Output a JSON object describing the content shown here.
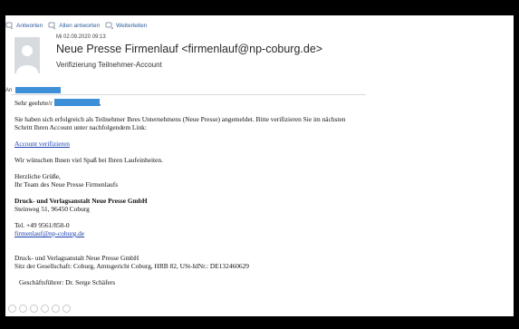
{
  "toolbar": {
    "reply": "Antworten",
    "reply_all": "Allen antworten",
    "forward": "Weiterleiten"
  },
  "message": {
    "date": "Mi 02.09.2020 09:13",
    "sender": "Neue Presse Firmenlauf <firmenlauf@np-coburg.de>",
    "subject": "Verifizierung Teilnehmer-Account",
    "to_label": "An"
  },
  "body": {
    "greeting_prefix": "Sehr geehrte/r",
    "greeting_suffix": ",",
    "para1_line1": "Sie haben sich erfolgreich als Teilnehmer Ihres Unternehmens (Neue Presse) angemeldet. Bitte verifizieren Sie im nächsten",
    "para1_line2": "Schritt Ihren Account unter nachfolgendem Link:",
    "verify_link": "Account verifizieren",
    "para2": "Wir wünschen Ihnen viel Spaß bei Ihren Laufeinheiten.",
    "closing_line1": "Herzliche Grüße,",
    "closing_line2": "Ihr Team des Neue Presse Firmenlaufs",
    "company_name": "Druck- und Verlagsanstalt Neue Presse GmbH",
    "company_address": "Steinweg 51, 96450 Coburg",
    "phone": "Tel.  +49 9561/850-0",
    "email_link": "firmenlauf@np-coburg.de",
    "footer_company": "Druck- und Verlagsanstalt Neue Presse GmbH",
    "footer_seat": "Sitz der Gesellschaft: Coburg, Amtsgericht Coburg, HRB 82, USt-IdNr.: DE132460629",
    "managing_director": "Geschäftsführer: Dr. Serge Schäfers"
  },
  "colors": {
    "redaction": "#3d8fd8",
    "link": "#1a3fb0",
    "toolbar_text": "#2b5b9c"
  }
}
